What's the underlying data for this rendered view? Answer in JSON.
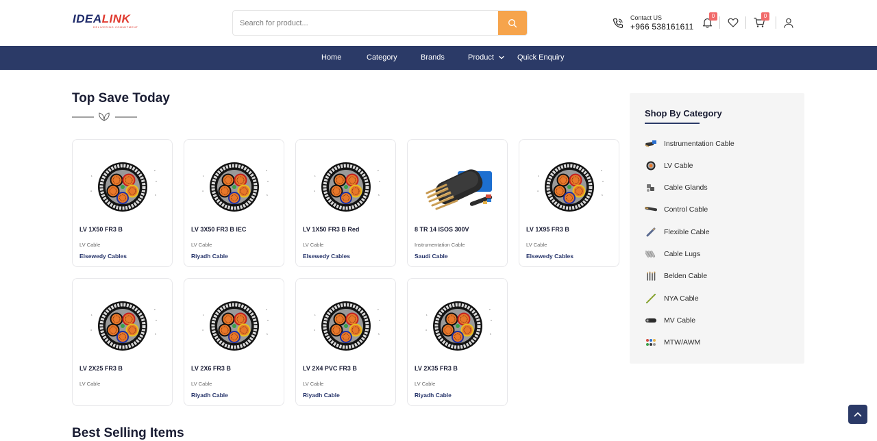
{
  "header": {
    "logo": {
      "brand_a": "IDEA",
      "brand_b": "LINK",
      "tagline": "DELIVERING COMMITMENT"
    },
    "search": {
      "placeholder": "Search for product..."
    },
    "contact": {
      "label": "Contact US",
      "phone": "+966 538161611"
    },
    "notifications": {
      "count": "0"
    },
    "cart": {
      "count": "0"
    }
  },
  "nav": {
    "items": [
      {
        "label": "Home"
      },
      {
        "label": "Category"
      },
      {
        "label": "Brands"
      },
      {
        "label": "Product"
      },
      {
        "label": "Quick Enquiry"
      }
    ]
  },
  "main": {
    "section_title": "Top Save Today",
    "products": [
      {
        "name": "LV 1X50 FR3 B",
        "category": "LV Cable",
        "brand": "Elsewedy Cables",
        "image": "lv-cable-cross-section"
      },
      {
        "name": "LV 3X50 FR3 B IEC",
        "category": "LV Cable",
        "brand": "Riyadh Cable",
        "image": "lv-cable-cross-section"
      },
      {
        "name": "LV 1X50 FR3 B Red",
        "category": "LV Cable",
        "brand": "Elsewedy Cables",
        "image": "lv-cable-cross-section"
      },
      {
        "name": "8 TR 14 ISOS 300V",
        "category": "Instrumentation Cable",
        "brand": "Saudi Cable",
        "image": "instrumentation-cable-bundle"
      },
      {
        "name": "LV 1X95 FR3 B",
        "category": "LV Cable",
        "brand": "Elsewedy Cables",
        "image": "lv-cable-cross-section"
      },
      {
        "name": "LV 2X25 FR3 B",
        "category": "LV Cable",
        "brand": "",
        "image": "lv-cable-cross-section"
      },
      {
        "name": "LV 2X6 FR3 B",
        "category": "LV Cable",
        "brand": "Riyadh Cable",
        "image": "lv-cable-cross-section"
      },
      {
        "name": "LV 2X4 PVC FR3 B",
        "category": "LV Cable",
        "brand": "Riyadh Cable",
        "image": "lv-cable-cross-section"
      },
      {
        "name": "LV 2X35 FR3 B",
        "category": "LV Cable",
        "brand": "Riyadh Cable",
        "image": "lv-cable-cross-section"
      }
    ],
    "next_section_title": "Best Selling Items"
  },
  "sidebar": {
    "title": "Shop By Category",
    "items": [
      {
        "label": "Instrumentation Cable",
        "icon": "instrumentation-cable-icon"
      },
      {
        "label": "LV Cable",
        "icon": "lv-cable-icon"
      },
      {
        "label": "Cable Glands",
        "icon": "cable-glands-icon"
      },
      {
        "label": "Control Cable",
        "icon": "control-cable-icon"
      },
      {
        "label": "Flexible Cable",
        "icon": "flexible-cable-icon"
      },
      {
        "label": "Cable Lugs",
        "icon": "cable-lugs-icon"
      },
      {
        "label": "Belden Cable",
        "icon": "belden-cable-icon"
      },
      {
        "label": "NYA Cable",
        "icon": "nya-cable-icon"
      },
      {
        "label": "MV Cable",
        "icon": "mv-cable-icon"
      },
      {
        "label": "MTW/AWM",
        "icon": "mtw-awm-icon"
      }
    ]
  },
  "colors": {
    "nav_bg": "#2b3a67",
    "search_button": "#f6a44c",
    "badge": "#f16a6a",
    "brand_text": "#27356b",
    "sidebar_bg": "#f5f5f5"
  }
}
